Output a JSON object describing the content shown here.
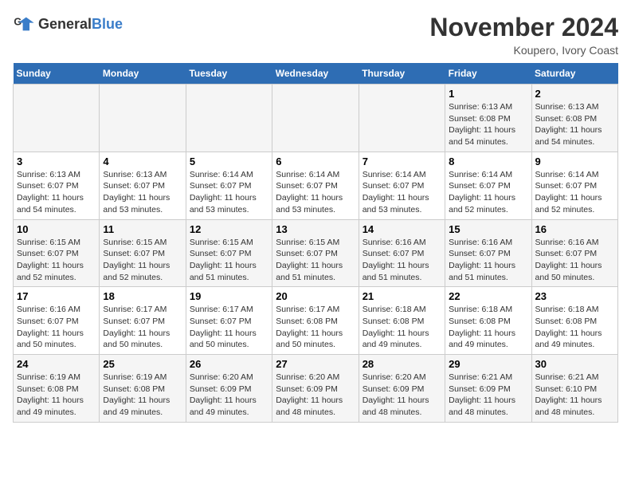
{
  "header": {
    "logo_general": "General",
    "logo_blue": "Blue",
    "title": "November 2024",
    "subtitle": "Koupero, Ivory Coast"
  },
  "days_of_week": [
    "Sunday",
    "Monday",
    "Tuesday",
    "Wednesday",
    "Thursday",
    "Friday",
    "Saturday"
  ],
  "weeks": [
    [
      {
        "day": "",
        "detail": ""
      },
      {
        "day": "",
        "detail": ""
      },
      {
        "day": "",
        "detail": ""
      },
      {
        "day": "",
        "detail": ""
      },
      {
        "day": "",
        "detail": ""
      },
      {
        "day": "1",
        "detail": "Sunrise: 6:13 AM\nSunset: 6:08 PM\nDaylight: 11 hours and 54 minutes."
      },
      {
        "day": "2",
        "detail": "Sunrise: 6:13 AM\nSunset: 6:08 PM\nDaylight: 11 hours and 54 minutes."
      }
    ],
    [
      {
        "day": "3",
        "detail": "Sunrise: 6:13 AM\nSunset: 6:07 PM\nDaylight: 11 hours and 54 minutes."
      },
      {
        "day": "4",
        "detail": "Sunrise: 6:13 AM\nSunset: 6:07 PM\nDaylight: 11 hours and 53 minutes."
      },
      {
        "day": "5",
        "detail": "Sunrise: 6:14 AM\nSunset: 6:07 PM\nDaylight: 11 hours and 53 minutes."
      },
      {
        "day": "6",
        "detail": "Sunrise: 6:14 AM\nSunset: 6:07 PM\nDaylight: 11 hours and 53 minutes."
      },
      {
        "day": "7",
        "detail": "Sunrise: 6:14 AM\nSunset: 6:07 PM\nDaylight: 11 hours and 53 minutes."
      },
      {
        "day": "8",
        "detail": "Sunrise: 6:14 AM\nSunset: 6:07 PM\nDaylight: 11 hours and 52 minutes."
      },
      {
        "day": "9",
        "detail": "Sunrise: 6:14 AM\nSunset: 6:07 PM\nDaylight: 11 hours and 52 minutes."
      }
    ],
    [
      {
        "day": "10",
        "detail": "Sunrise: 6:15 AM\nSunset: 6:07 PM\nDaylight: 11 hours and 52 minutes."
      },
      {
        "day": "11",
        "detail": "Sunrise: 6:15 AM\nSunset: 6:07 PM\nDaylight: 11 hours and 52 minutes."
      },
      {
        "day": "12",
        "detail": "Sunrise: 6:15 AM\nSunset: 6:07 PM\nDaylight: 11 hours and 51 minutes."
      },
      {
        "day": "13",
        "detail": "Sunrise: 6:15 AM\nSunset: 6:07 PM\nDaylight: 11 hours and 51 minutes."
      },
      {
        "day": "14",
        "detail": "Sunrise: 6:16 AM\nSunset: 6:07 PM\nDaylight: 11 hours and 51 minutes."
      },
      {
        "day": "15",
        "detail": "Sunrise: 6:16 AM\nSunset: 6:07 PM\nDaylight: 11 hours and 51 minutes."
      },
      {
        "day": "16",
        "detail": "Sunrise: 6:16 AM\nSunset: 6:07 PM\nDaylight: 11 hours and 50 minutes."
      }
    ],
    [
      {
        "day": "17",
        "detail": "Sunrise: 6:16 AM\nSunset: 6:07 PM\nDaylight: 11 hours and 50 minutes."
      },
      {
        "day": "18",
        "detail": "Sunrise: 6:17 AM\nSunset: 6:07 PM\nDaylight: 11 hours and 50 minutes."
      },
      {
        "day": "19",
        "detail": "Sunrise: 6:17 AM\nSunset: 6:07 PM\nDaylight: 11 hours and 50 minutes."
      },
      {
        "day": "20",
        "detail": "Sunrise: 6:17 AM\nSunset: 6:08 PM\nDaylight: 11 hours and 50 minutes."
      },
      {
        "day": "21",
        "detail": "Sunrise: 6:18 AM\nSunset: 6:08 PM\nDaylight: 11 hours and 49 minutes."
      },
      {
        "day": "22",
        "detail": "Sunrise: 6:18 AM\nSunset: 6:08 PM\nDaylight: 11 hours and 49 minutes."
      },
      {
        "day": "23",
        "detail": "Sunrise: 6:18 AM\nSunset: 6:08 PM\nDaylight: 11 hours and 49 minutes."
      }
    ],
    [
      {
        "day": "24",
        "detail": "Sunrise: 6:19 AM\nSunset: 6:08 PM\nDaylight: 11 hours and 49 minutes."
      },
      {
        "day": "25",
        "detail": "Sunrise: 6:19 AM\nSunset: 6:08 PM\nDaylight: 11 hours and 49 minutes."
      },
      {
        "day": "26",
        "detail": "Sunrise: 6:20 AM\nSunset: 6:09 PM\nDaylight: 11 hours and 49 minutes."
      },
      {
        "day": "27",
        "detail": "Sunrise: 6:20 AM\nSunset: 6:09 PM\nDaylight: 11 hours and 48 minutes."
      },
      {
        "day": "28",
        "detail": "Sunrise: 6:20 AM\nSunset: 6:09 PM\nDaylight: 11 hours and 48 minutes."
      },
      {
        "day": "29",
        "detail": "Sunrise: 6:21 AM\nSunset: 6:09 PM\nDaylight: 11 hours and 48 minutes."
      },
      {
        "day": "30",
        "detail": "Sunrise: 6:21 AM\nSunset: 6:10 PM\nDaylight: 11 hours and 48 minutes."
      }
    ]
  ]
}
